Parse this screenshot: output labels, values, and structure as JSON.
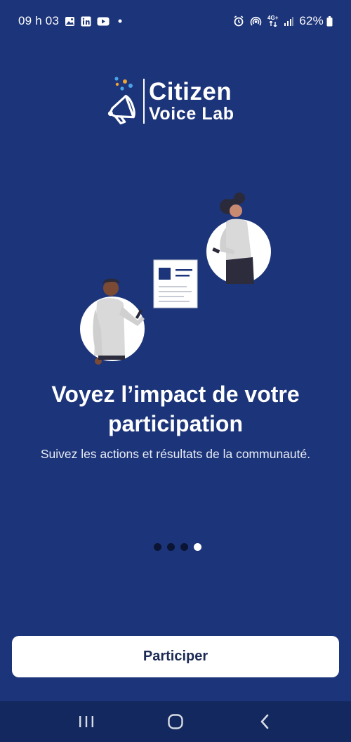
{
  "status_bar": {
    "time": "09 h 03",
    "battery": "62%",
    "network": "4G+",
    "icons": [
      "image-icon",
      "linkedin-icon",
      "youtube-icon",
      "notification-dot-icon",
      "alarm-icon",
      "hotspot-icon",
      "network-icon",
      "signal-icon",
      "battery-icon"
    ]
  },
  "logo": {
    "line1": "Citizen",
    "line2": "Voice Lab",
    "icon": "megaphone-icon"
  },
  "onboarding": {
    "title": "Voyez l’impact de votre participation",
    "subtitle": "Suivez les actions et résultats de la communauté.",
    "page_count": 4,
    "active_page": 4
  },
  "cta": {
    "label": "Participer"
  },
  "nav_bar": {
    "icons": [
      "recent-apps-icon",
      "home-icon",
      "back-icon"
    ]
  },
  "colors": {
    "background": "#1c3479",
    "button_text": "#1c2a55",
    "dot_inactive": "#0b1433",
    "dot_active": "#ffffff"
  }
}
